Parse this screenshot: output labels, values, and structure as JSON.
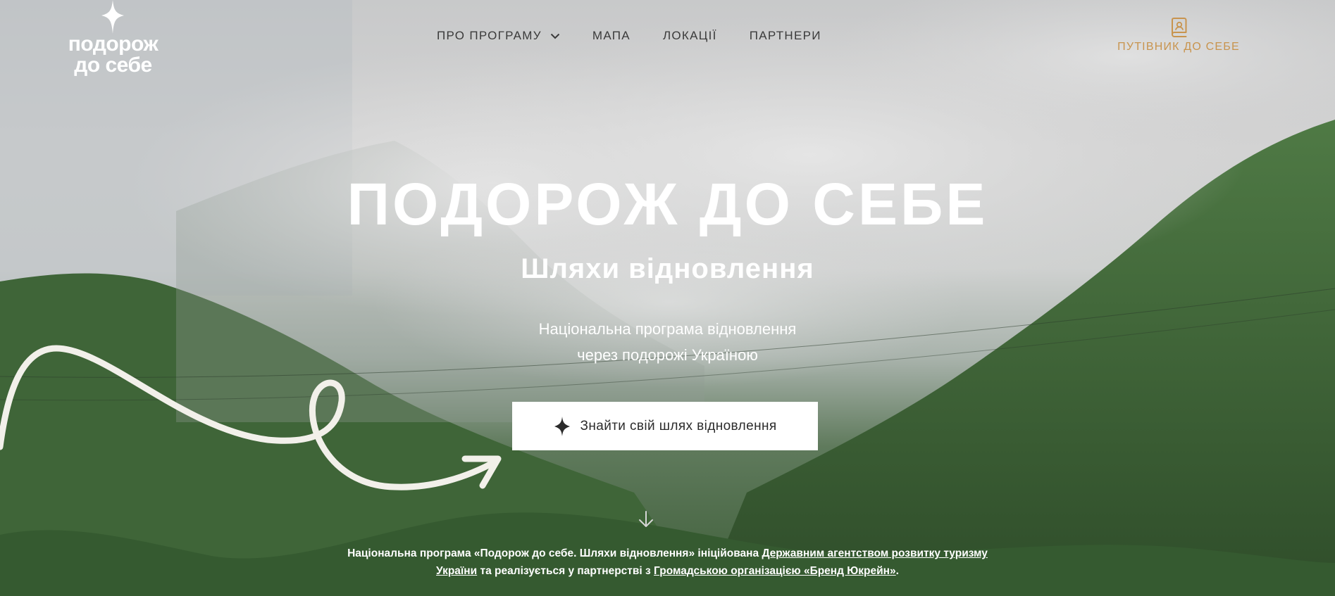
{
  "header": {
    "logo": {
      "line1": "подорож",
      "line2": "до себе"
    },
    "nav": [
      {
        "label": "ПРО ПРОГРАМУ",
        "has_dropdown": true
      },
      {
        "label": "МАПА"
      },
      {
        "label": "ЛОКАЦІЇ"
      },
      {
        "label": "ПАРТНЕРИ"
      }
    ],
    "guide": {
      "label": "ПУТІВНИК ДО СЕБЕ",
      "icon": "guidebook-icon",
      "color": "#c8944e"
    }
  },
  "hero": {
    "title": "ПОДОРОЖ ДО СЕБЕ",
    "subtitle": "Шляхи відновлення",
    "description_line1": "Національна програма відновлення",
    "description_line2": "через подорожі Україною",
    "cta_label": "Знайти свій шлях відновлення",
    "cta_icon": "sparkle-star-icon"
  },
  "footer_note": {
    "part1": "Національна програма «Подорож до себе. Шляхи відновлення» ініційована ",
    "link1": "Державним агентством розвитку туризму",
    "link1_cont": "України",
    "part2": " та реалізується у партнерстві з ",
    "link2": "Громадською організацією «Бренд Юкрейн»",
    "part3": "."
  },
  "colors": {
    "accent": "#c8944e",
    "text_light": "#ffffff",
    "nav_text": "#3a3a3a",
    "button_bg": "#ffffff"
  }
}
